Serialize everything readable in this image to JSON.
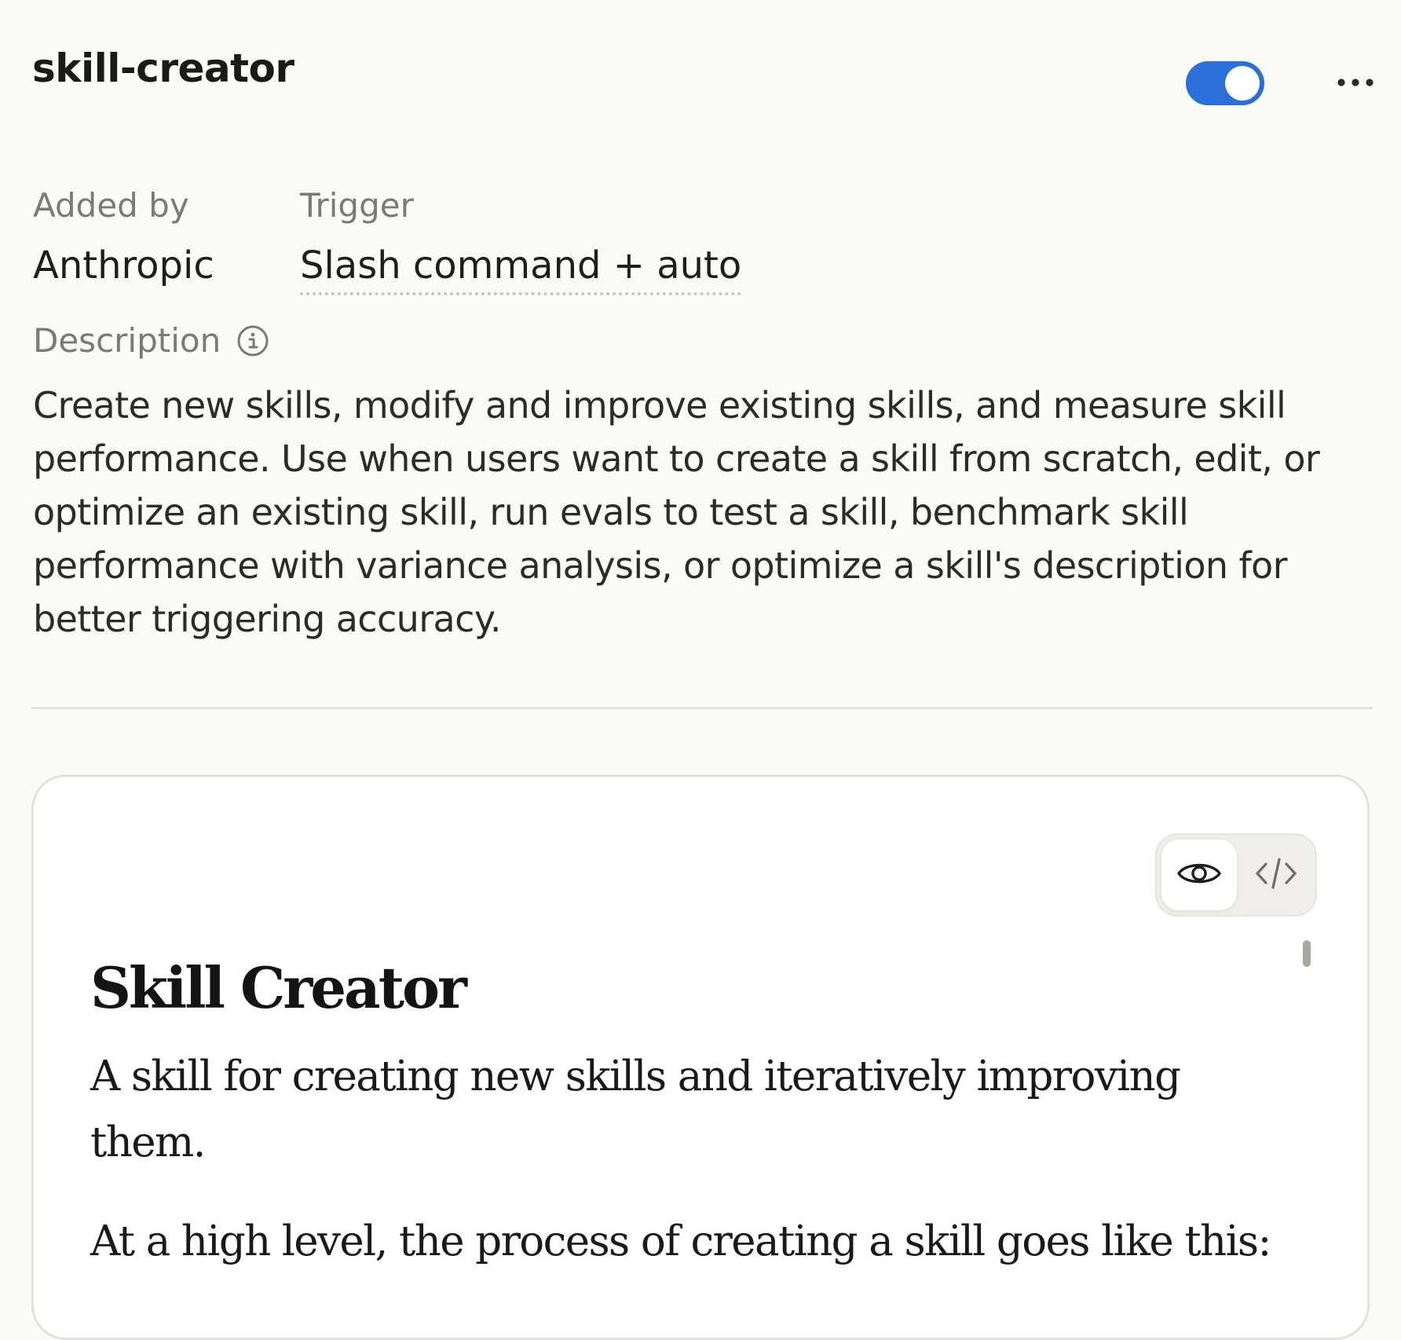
{
  "header": {
    "skill_name": "skill-creator",
    "toggle_enabled": true,
    "more_icon": "more-horizontal-icon"
  },
  "meta": {
    "added_by_label": "Added by",
    "added_by_value": "Anthropic",
    "trigger_label": "Trigger",
    "trigger_value": "Slash command + auto"
  },
  "description": {
    "label": "Description",
    "info_icon": "info-icon",
    "text": "Create new skills, modify and improve existing skills, and measure skill performance. Use when users want to create a skill from scratch, edit, or optimize an existing skill, run evals to test a skill, benchmark skill performance with variance analysis, or optimize a skill's description for better triggering accuracy."
  },
  "preview": {
    "view_modes": [
      {
        "name": "preview",
        "icon": "eye-icon",
        "active": true
      },
      {
        "name": "code",
        "icon": "code-icon",
        "active": false
      }
    ],
    "title": "Skill Creator",
    "paragraph1": "A skill for creating new skills and iteratively improving them.",
    "paragraph2": "At a high level, the process of creating a skill goes like this:"
  },
  "colors": {
    "toggle_on": "#2c6fd6",
    "background": "#fafaf8",
    "muted_text": "#7c7a75"
  }
}
